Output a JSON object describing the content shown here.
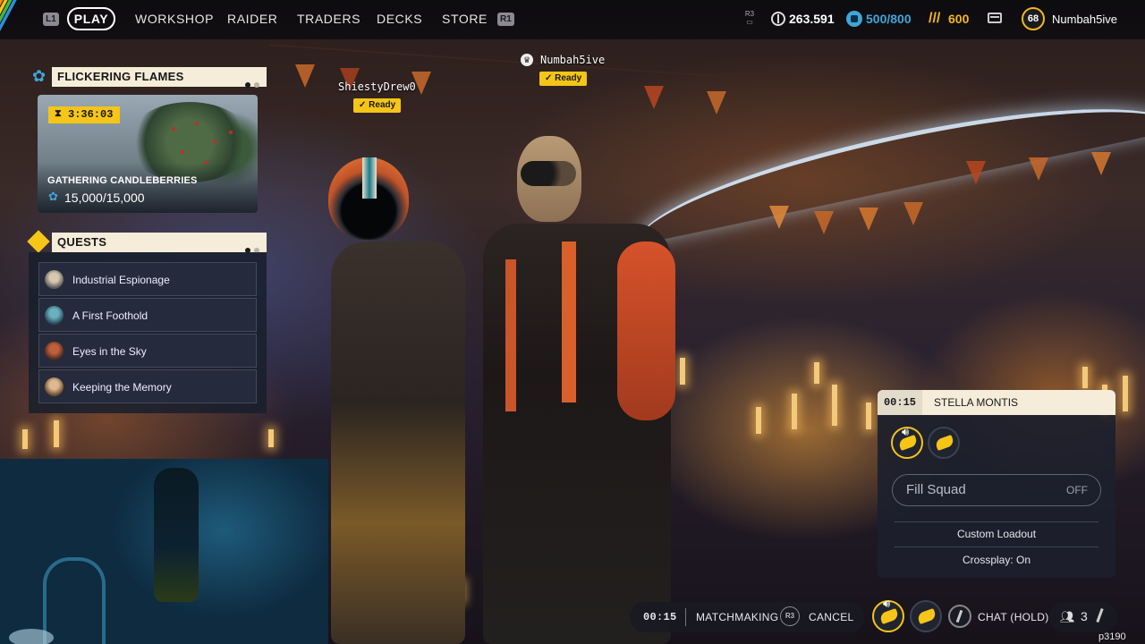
{
  "topbar": {
    "left_key": "L1",
    "right_key": "R1",
    "nav": [
      {
        "label": "PLAY",
        "active": true
      },
      {
        "label": "WORKSHOP"
      },
      {
        "label": "RAIDER"
      },
      {
        "label": "TRADERS"
      },
      {
        "label": "DECKS"
      },
      {
        "label": "STORE"
      }
    ],
    "r3_key": "R3",
    "currency_coins": "263.591",
    "currency_blue": "500/800",
    "currency_gold": "600",
    "player_level": "68",
    "player_name": "Numbah5ive",
    "colors": {
      "accent_yellow": "#f5c518",
      "blue": "#3ea6d8",
      "gold": "#f2b51a"
    }
  },
  "event": {
    "title": "FLICKERING FLAMES",
    "timer": "3:36:03",
    "name": "GATHERING CANDLEBERRIES",
    "progress": "15,000/15,000"
  },
  "quests": {
    "title": "QUESTS",
    "items": [
      {
        "label": "Industrial Espionage"
      },
      {
        "label": "A First Foothold"
      },
      {
        "label": "Eyes in the Sky"
      },
      {
        "label": "Keeping the Memory"
      }
    ]
  },
  "players": [
    {
      "name": "ShiestyDrew0",
      "status": "Ready"
    },
    {
      "name": "Numbah5ive",
      "status": "Ready"
    }
  ],
  "lobby": {
    "time": "00:15",
    "map": "STELLA MONTIS",
    "fill_squad_label": "Fill Squad",
    "fill_squad_value": "OFF",
    "custom_loadout": "Custom Loadout",
    "crossplay": "Crossplay: On"
  },
  "bottom": {
    "time": "00:15",
    "matchmaking": "MATCHMAKING",
    "r3_key": "R3",
    "cancel": "CANCEL",
    "chat": "CHAT (HOLD)",
    "party_count": "3",
    "build_code": "p3190"
  }
}
